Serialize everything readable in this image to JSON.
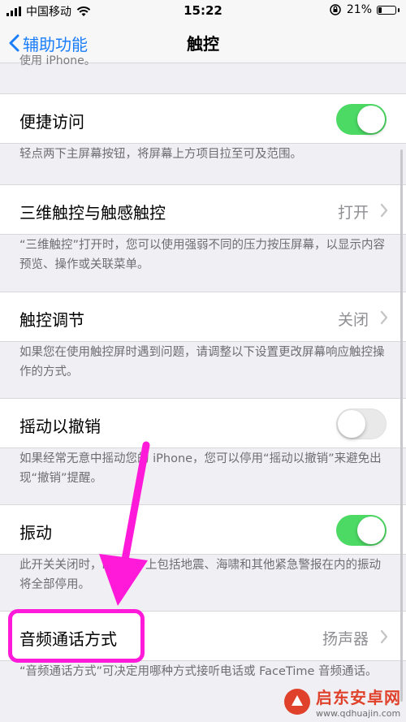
{
  "status_bar": {
    "carrier": "中国移动",
    "time": "15:22",
    "battery": "21%",
    "battery_level": 0.21
  },
  "nav": {
    "back_label": "辅助功能",
    "title": "触控",
    "prev_text": "使用 iPhone。"
  },
  "sections": {
    "reachability": {
      "label": "便捷访问",
      "toggle_on": true,
      "description": "轻点两下主屏幕按钮，将屏幕上方项目拉至可及范围。"
    },
    "touch_3d": {
      "label": "三维触控与触感触控",
      "value": "打开",
      "description": "“三维触控”打开时，您可以使用强弱不同的压力按压屏幕，以显示内容预览、操作或关联菜单。"
    },
    "touch_accommodations": {
      "label": "触控调节",
      "value": "关闭",
      "description": "如果您在使用触控屏时遇到问题，请调整以下设置更改屏幕响应触控操作的方式。"
    },
    "shake_to_undo": {
      "label": "摇动以撤销",
      "toggle_on": false,
      "description": "如果经常无意中摇动您的 iPhone，您可以停用“摇动以撤销”来避免出现“撤销”提醒。"
    },
    "vibration": {
      "label": "振动",
      "toggle_on": true,
      "description": "此开关关闭时，iPhone 上包括地震、海啸和其他紧急警报在内的振动将全部停用。"
    },
    "call_audio_routing": {
      "label": "音频通话方式",
      "value": "扬声器",
      "description": "“音频通话方式”可决定用哪种方式接听电话或 FaceTime 音频通话。"
    }
  },
  "watermark": {
    "name": "启东安卓网",
    "url": "www.qdhuajin.com"
  },
  "colors": {
    "accent": "#1a7dfb",
    "toggle_on": "#4cd964",
    "annotation": "#ff1ad9",
    "watermark": "#e0412a"
  },
  "icons": {
    "back": "chevron-left-icon",
    "disclosure": "chevron-right-icon",
    "wifi": "wifi-icon",
    "lock": "orientation-lock-icon",
    "battery": "battery-icon",
    "annotation_arrow": "arrow-icon"
  }
}
